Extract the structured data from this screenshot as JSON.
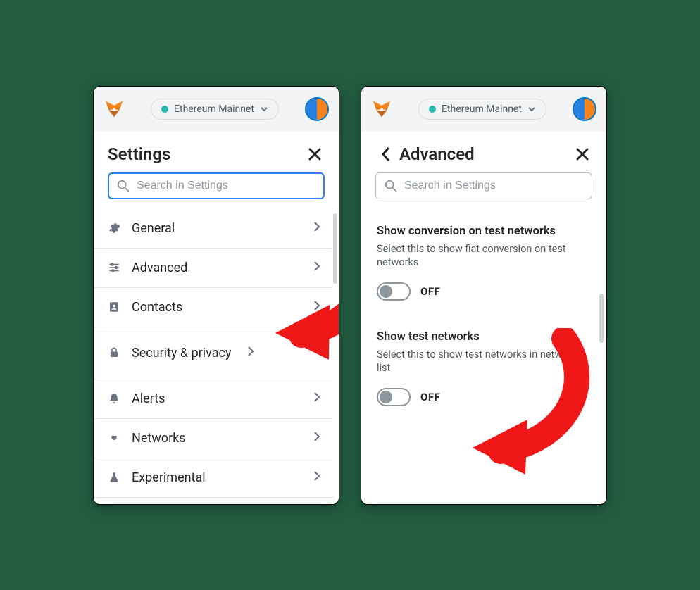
{
  "network_label": "Ethereum Mainnet",
  "left": {
    "title": "Settings",
    "search_placeholder": "Search in Settings",
    "items": [
      {
        "id": "general",
        "label": "General",
        "icon": "gear"
      },
      {
        "id": "advanced",
        "label": "Advanced",
        "icon": "sliders"
      },
      {
        "id": "contacts",
        "label": "Contacts",
        "icon": "contacts"
      },
      {
        "id": "security",
        "label": "Security & privacy",
        "icon": "lock"
      },
      {
        "id": "alerts",
        "label": "Alerts",
        "icon": "bell"
      },
      {
        "id": "networks",
        "label": "Networks",
        "icon": "plug"
      },
      {
        "id": "experimental",
        "label": "Experimental",
        "icon": "flask"
      }
    ]
  },
  "right": {
    "title": "Advanced",
    "search_placeholder": "Search in Settings",
    "settings": [
      {
        "title": "Show conversion on test networks",
        "desc": "Select this to show fiat conversion on test networks",
        "state_label": "OFF"
      },
      {
        "title": "Show test networks",
        "desc": "Select this to show test networks in network list",
        "state_label": "OFF"
      }
    ]
  }
}
